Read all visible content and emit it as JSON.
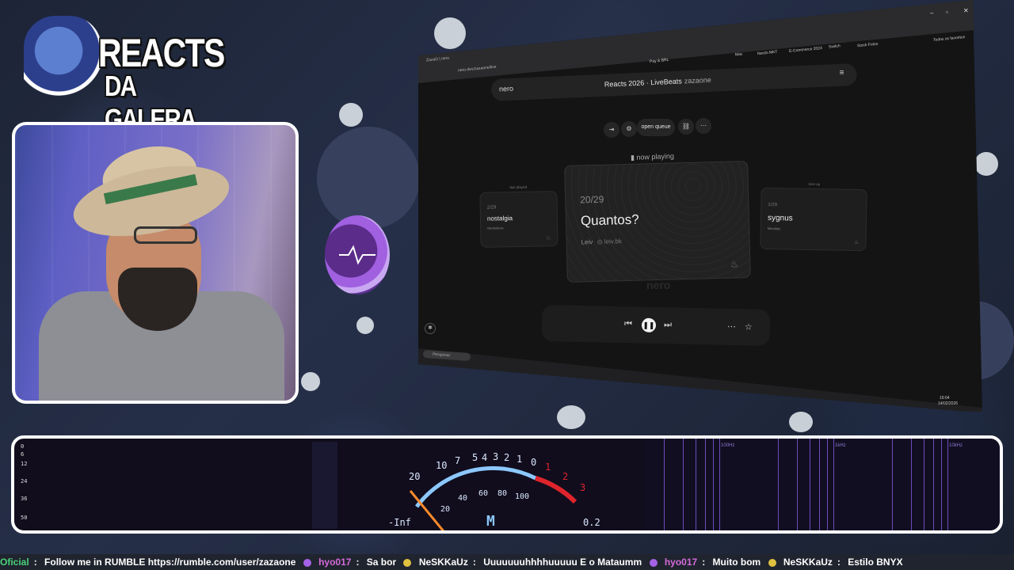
{
  "overlay": {
    "logo_line1": "REACTS",
    "logo_line2": "DA GALERA"
  },
  "browser": {
    "tab_title": "ZazaO | nero",
    "url": "nero.dev/zazaone/live",
    "bookmarks": [
      "Pay & BRL",
      "Mac",
      "Nerdo MKT",
      "E-Commerce 2024",
      "Switch",
      "Stock Fotos",
      "Todos os favoritos"
    ]
  },
  "app": {
    "brand": "nero",
    "title": "Reacts 2026 · LiveBeats",
    "user": "zazaone",
    "open_queue_label": "open queue",
    "now_playing_label": "now playing",
    "prev_card": {
      "label": "last played",
      "num": "2/29",
      "name": "nostalgia",
      "artist": "Nerdelanes"
    },
    "current_card": {
      "num": "20/29",
      "name": "Quantos?",
      "artist": "Leiv",
      "instagram": "leiv.bk"
    },
    "next_card": {
      "label": "next up",
      "num": "1/29",
      "name": "sygnus",
      "artist": "Mbodaby"
    },
    "watermark": "nero"
  },
  "taskbar": {
    "search_placeholder": "Pesquisar",
    "time": "19:04",
    "date": "14/02/2026"
  },
  "audio": {
    "db_scale": [
      "0",
      "6",
      "12",
      "24",
      "36",
      "50"
    ],
    "vu_top": [
      "20",
      "10",
      "7",
      "5",
      "4",
      "3",
      "2",
      "1",
      "0",
      "1",
      "2",
      "3"
    ],
    "vu_bottom": [
      "20",
      "40",
      "60",
      "80",
      "100"
    ],
    "left_value": "-Inf",
    "channel": "M",
    "right_value": "0.2",
    "freq_labels": [
      "100Hz",
      "1kHz",
      "10kHz"
    ]
  },
  "ticker": {
    "items": [
      {
        "user": "Oficial",
        "msg": "Follow me in RUMBLE https://rumble.com/user/zazaone"
      },
      {
        "user": "hyo017",
        "msg": "Sa bor"
      },
      {
        "user": "NeSKKaUz",
        "msg": "Uuuuuuuhhhhuuuuu  E o Mataumm"
      },
      {
        "user": "hyo017",
        "msg": "Muito bom"
      },
      {
        "user": "NeSKKaUz",
        "msg": "Estilo BNYX"
      }
    ]
  },
  "colors": {
    "vu_arc": "#8cc8ff",
    "vu_red": "#e0242c",
    "needle": "#ff8a2a",
    "chat_user_green": "#49d27a",
    "chat_user_pink": "#d46bdc"
  }
}
